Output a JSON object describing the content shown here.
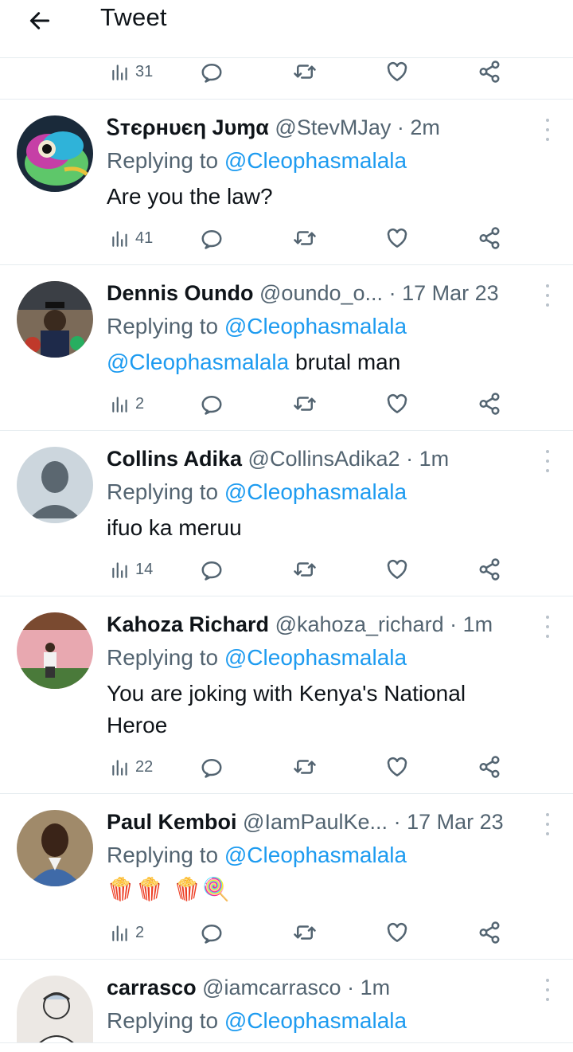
{
  "header": {
    "title": "Tweet"
  },
  "top_actions": {
    "views": "31"
  },
  "tweets": [
    {
      "name": "Ꮪтєρнυєη Jυɱα",
      "handle": "@StevMJay",
      "separator": "·",
      "time": "2m",
      "replying_prefix": "Replying to",
      "reply_to": "@Cleophasmalala",
      "text_mention": "",
      "text": "Are you the law?",
      "views": "41"
    },
    {
      "name": "Dennis Oundo",
      "handle": "@oundo_o...",
      "separator": "·",
      "time": "17 Mar 23",
      "replying_prefix": "Replying to",
      "reply_to": "@Cleophasmalala",
      "text_mention": "@Cleophasmalala",
      "text": " brutal man",
      "views": "2"
    },
    {
      "name": "Collins Adika",
      "handle": "@CollinsAdika2",
      "separator": "·",
      "time": "1m",
      "replying_prefix": "Replying to",
      "reply_to": "@Cleophasmalala",
      "text_mention": "",
      "text": "ifuo ka meruu",
      "views": "14"
    },
    {
      "name": "Kahoza Richard",
      "handle": "@kahoza_richard",
      "separator": "·",
      "time": "1m",
      "replying_prefix": "Replying to",
      "reply_to": "@Cleophasmalala",
      "text_mention": "",
      "text": "You are joking with Kenya's National Heroe",
      "views": "22"
    },
    {
      "name": "Paul Kemboi",
      "handle": "@IamPaulKe...",
      "separator": "·",
      "time": "17 Mar 23",
      "replying_prefix": "Replying to",
      "reply_to": "@Cleophasmalala",
      "text_mention": "",
      "text": "🍿🍿 🍿🍭",
      "views": "2"
    },
    {
      "name": "carrasco",
      "handle": "@iamcarrasco",
      "separator": "·",
      "time": "1m",
      "replying_prefix": "Replying to",
      "reply_to": "@Cleophasmalala",
      "text_mention": "",
      "text": "",
      "views": ""
    }
  ],
  "icons": {
    "back": "arrow-left-icon",
    "views": "bar-chart-icon",
    "reply": "speech-bubble-icon",
    "retweet": "retweet-icon",
    "like": "heart-icon",
    "share": "share-icon",
    "more": "more-vertical-icon"
  },
  "colors": {
    "link": "#1d9bf0",
    "secondary": "#536471",
    "text": "#0f1419",
    "divider": "#e6ecf0"
  }
}
